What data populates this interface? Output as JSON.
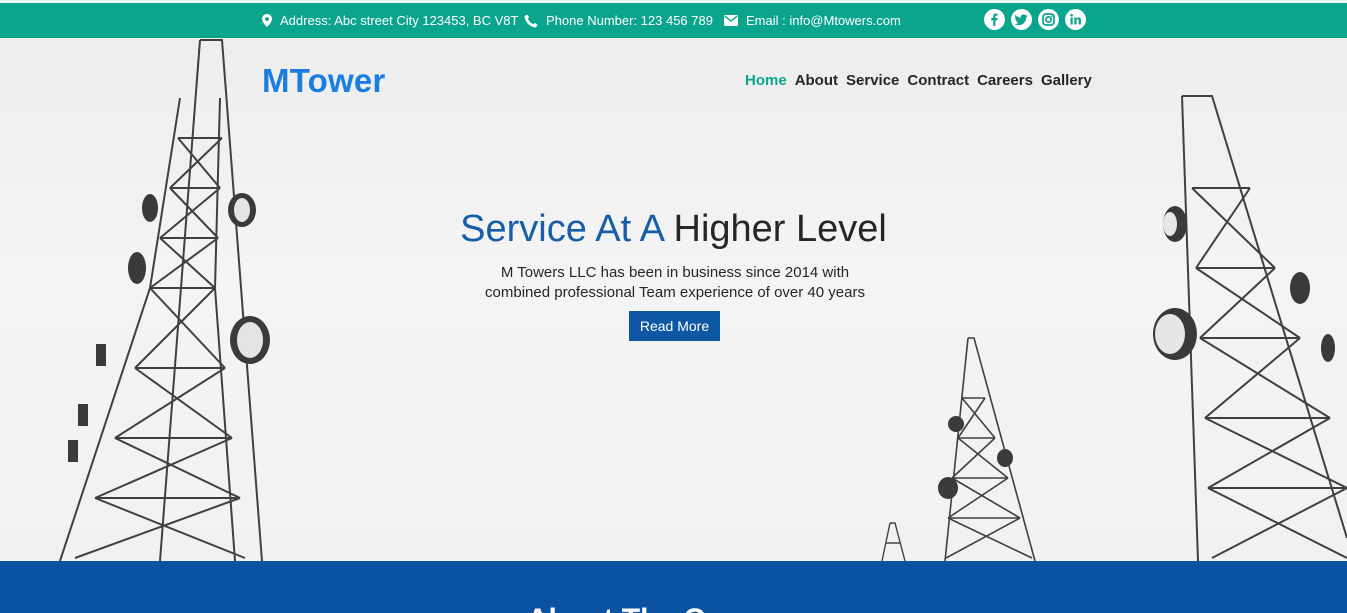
{
  "topbar": {
    "address": "Address: Abc street City 123453, BC V8T",
    "phone": "Phone Number: 123 456 789",
    "email": "Email : info@Mtowers.com",
    "socials": [
      "facebook-icon",
      "twitter-icon",
      "instagram-icon",
      "linkedin-icon"
    ]
  },
  "header": {
    "logo": "MTower",
    "nav": [
      "Home",
      "About",
      "Service",
      "Contract",
      "Careers",
      "Gallery"
    ],
    "active_nav": "Home"
  },
  "hero": {
    "headline_accent": "Service At A",
    "headline_rest": "Higher Level",
    "subtext": "M Towers LLC has been in business since 2014 with combined professional Team experience of over 40 years",
    "button": "Read More"
  },
  "about": {
    "title": "About The Company"
  },
  "colors": {
    "topbar": "#0aa58c",
    "logo": "#1a7ee0",
    "headline_accent": "#175ea8",
    "button": "#0d57a3",
    "about_band": "#0b52a1",
    "nav_active": "#0aa58c"
  }
}
